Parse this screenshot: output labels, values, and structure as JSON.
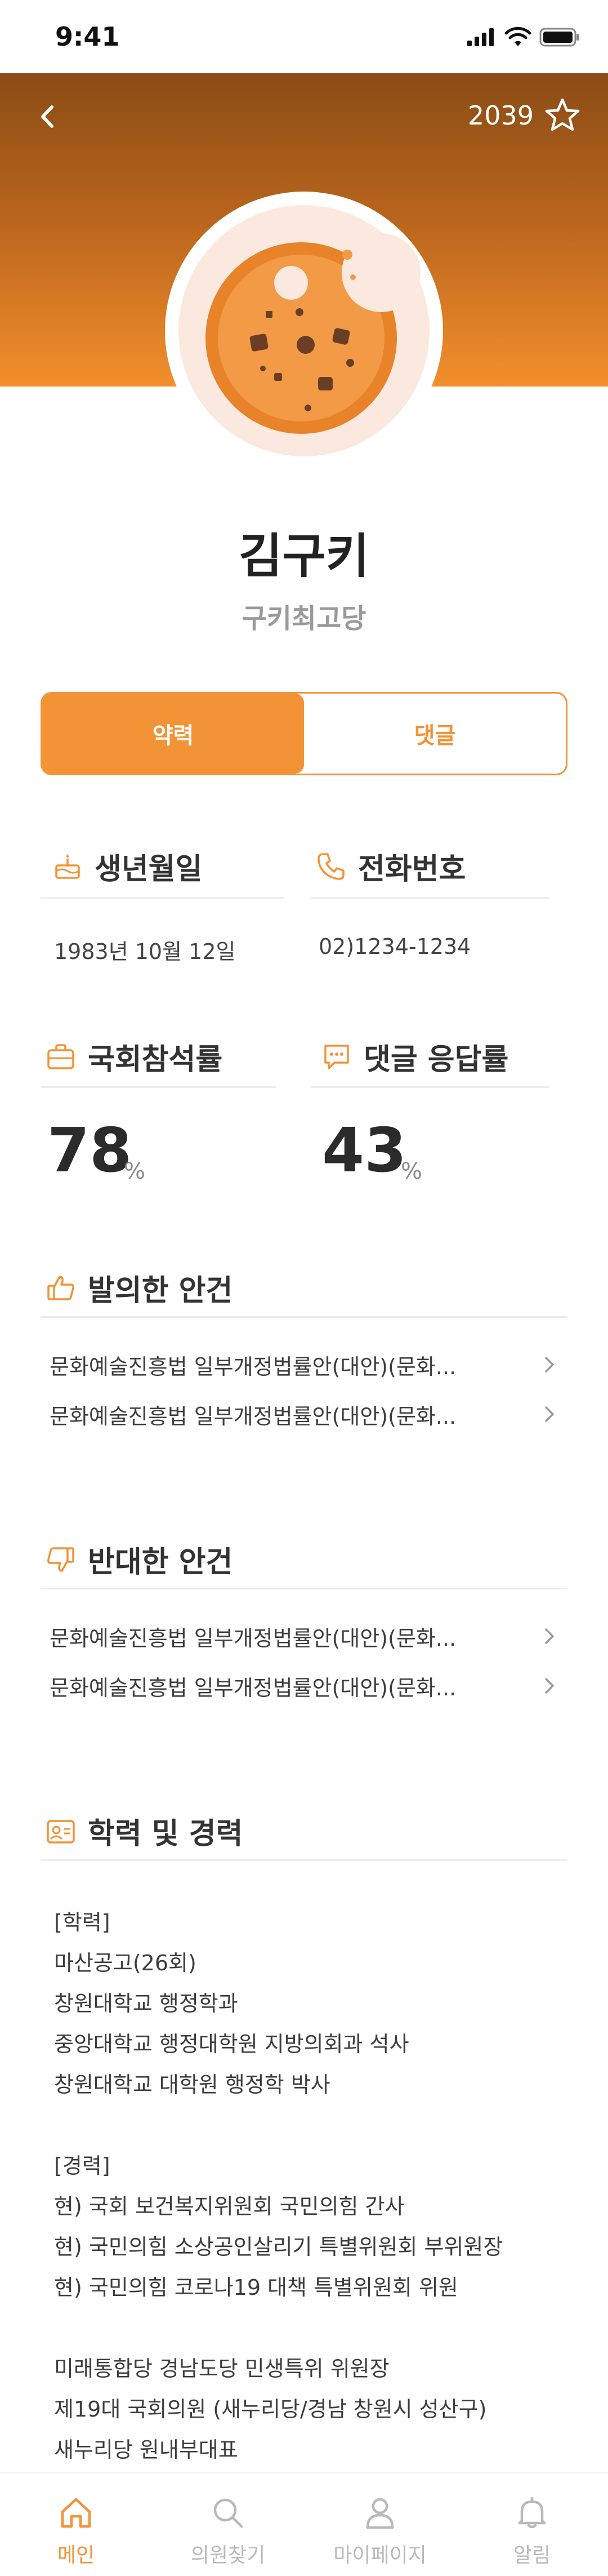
{
  "status_bar": {
    "time": "9:41"
  },
  "header": {
    "favorite_count": "2039"
  },
  "profile": {
    "name": "김구키",
    "party": "구키최고당"
  },
  "tabs": [
    {
      "label": "약력"
    },
    {
      "label": "댓글"
    }
  ],
  "info": {
    "birthday": {
      "label": "생년월일",
      "value": "1983년 10월 12일"
    },
    "phone": {
      "label": "전화번호",
      "value": "02)1234-1234"
    },
    "attendance": {
      "label": "국회참석률",
      "value": "78",
      "unit": "%"
    },
    "reply_rate": {
      "label": "댓글 응답률",
      "value": "43",
      "unit": "%"
    }
  },
  "proposed": {
    "title": "발의한 안건",
    "items": [
      "문화예술진흥법 일부개정법률안(대안)(문화...",
      "문화예술진흥법 일부개정법률안(대안)(문화..."
    ]
  },
  "opposed": {
    "title": "반대한 안건",
    "items": [
      "문화예술진흥법 일부개정법률안(대안)(문화...",
      "문화예술진흥법 일부개정법률안(대안)(문화..."
    ]
  },
  "career": {
    "title": "학력 및 경력",
    "education_header": "[학력]",
    "education": [
      "마산공고(26회)",
      "창원대학교 행정학과",
      "중앙대학교 행정대학원 지방의회과 석사",
      "창원대학교 대학원 행정학 박사"
    ],
    "career_header": "[경력]",
    "career_items": [
      "현) 국회 보건복지위원회 국민의힘 간사",
      "현) 국민의힘 소상공인살리기 특별위원회 부위원장",
      "현) 국민의힘 코로나19 대책 특별위원회 위원"
    ],
    "extra_items": [
      "미래통합당 경남도당 민생특위 위원장",
      "제19대 국회의원 (새누리당/경남 창원시 성산구)",
      "새누리당 원내부대표"
    ]
  },
  "bottom_nav": [
    {
      "label": "메인"
    },
    {
      "label": "의원찾기"
    },
    {
      "label": "마이페이지"
    },
    {
      "label": "알림"
    }
  ],
  "colors": {
    "accent": "#f29335",
    "hero_top": "#8a4c15",
    "hero_bottom": "#f28f2c"
  }
}
